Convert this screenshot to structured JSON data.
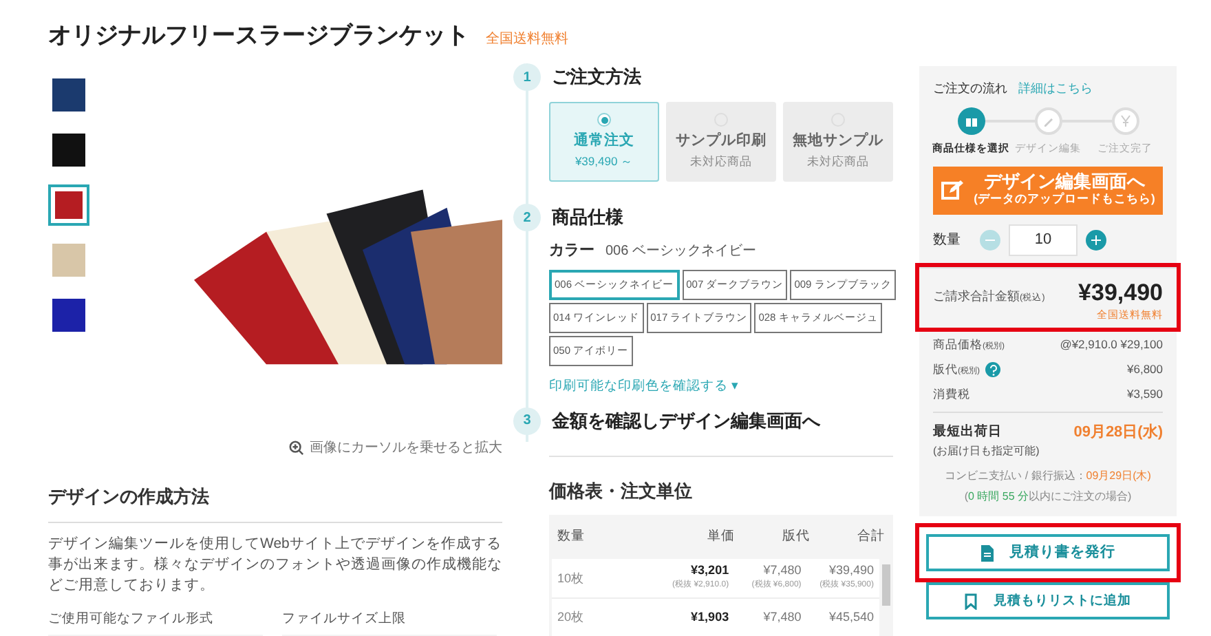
{
  "title": "オリジナルフリースラージブランケット",
  "title_badge": "全国送料無料",
  "thumbnails": [
    {
      "selected": false
    },
    {
      "selected": false
    },
    {
      "selected": true
    },
    {
      "selected": false
    },
    {
      "selected": false
    }
  ],
  "zoom_hint": "画像にカーソルを乗せると拡大",
  "design_section": {
    "heading": "デザインの作成方法",
    "text": "デザイン編集ツールを使用してWebサイト上でデザインを作成する事が出来ます。様々なデザインのフォントや透過画像の作成機能などご用意しております。",
    "columns": [
      "ご使用可能なファイル形式",
      "ファイルサイズ上限"
    ]
  },
  "steps": [
    {
      "number": "1",
      "heading": "ご注文方法"
    },
    {
      "number": "2",
      "heading": "商品仕様"
    },
    {
      "number": "3",
      "heading": "金額を確認しデザイン編集画面へ"
    }
  ],
  "order_methods": [
    {
      "label": "通常注文",
      "sub": "¥39,490 ～",
      "selected": true,
      "disabled": false
    },
    {
      "label": "サンプル印刷",
      "sub": "未対応商品",
      "selected": false,
      "disabled": true
    },
    {
      "label": "無地サンプル",
      "sub": "未対応商品",
      "selected": false,
      "disabled": true
    }
  ],
  "color_label": "カラー",
  "color_value": "006 ベーシックネイビー",
  "colors": [
    {
      "label": "006 ベーシックネイビー",
      "selected": true
    },
    {
      "label": "007 ダークブラウン",
      "selected": false
    },
    {
      "label": "009 ランプブラック",
      "selected": false
    },
    {
      "label": "014 ワインレッド",
      "selected": false
    },
    {
      "label": "017 ライトブラウン",
      "selected": false
    },
    {
      "label": "028 キャラメルベージュ",
      "selected": false
    },
    {
      "label": "050 アイボリー",
      "selected": false
    }
  ],
  "print_colors_link": "印刷可能な印刷色を確認する ▾",
  "price_table": {
    "heading": "価格表・注文単位",
    "columns": [
      "数量",
      "単価",
      "版代",
      "合計"
    ],
    "rows": [
      {
        "qty": "10枚",
        "unit": "¥3,201",
        "unit_note": "(税抜 ¥2,910.0)",
        "plate": "¥7,480",
        "plate_note": "(税抜 ¥6,800)",
        "total": "¥39,490",
        "total_note": "(税抜 ¥35,900)"
      },
      {
        "qty": "20枚",
        "unit": "¥1,903",
        "plate": "¥7,480",
        "total": "¥45,540"
      }
    ]
  },
  "sidebar": {
    "flow_title": "ご注文の流れ",
    "flow_link": "詳細はこちら",
    "flow_steps": [
      {
        "kind": "gift",
        "label": "商品仕様を選択",
        "active": true
      },
      {
        "kind": "pencil",
        "label": "デザイン編集",
        "active": false
      },
      {
        "kind": "yen",
        "label": "ご注文完了",
        "active": false
      }
    ],
    "design_button": {
      "label": "デザイン編集画面へ",
      "sub": "(データのアップロードもこちら)"
    },
    "quantity_label": "数量",
    "quantity": "10",
    "total": {
      "highlighted": true,
      "label": "ご請求合計金額",
      "note": "(税込)",
      "amount": "¥39,490",
      "shipping": "全国送料無料"
    },
    "breakdown": [
      {
        "label": "商品価格",
        "note": "(税別)",
        "help": false,
        "value": "@¥2,910.0 ¥29,100"
      },
      {
        "label": "版代",
        "note": "(税別)",
        "help": true,
        "value": "¥6,800"
      },
      {
        "label": "消費税",
        "help": false,
        "value": "¥3,590"
      }
    ],
    "ship_label": "最短出荷日",
    "ship_date": "09月28日(水)",
    "ship_note": "(お届け日も指定可能)",
    "conv_label": "コンビニ支払い / 銀行振込：",
    "conv_date": "09月29日(木)",
    "deadline": [
      {
        "kind": "plain",
        "text": "("
      },
      {
        "kind": "accent",
        "text": "0 時間 55 分"
      },
      {
        "kind": "plain",
        "text": "以内にご注文の場合)"
      }
    ],
    "quote_button": {
      "label": "見積り書を発行",
      "highlighted": true
    },
    "list_button": "見積もりリストに追加"
  }
}
